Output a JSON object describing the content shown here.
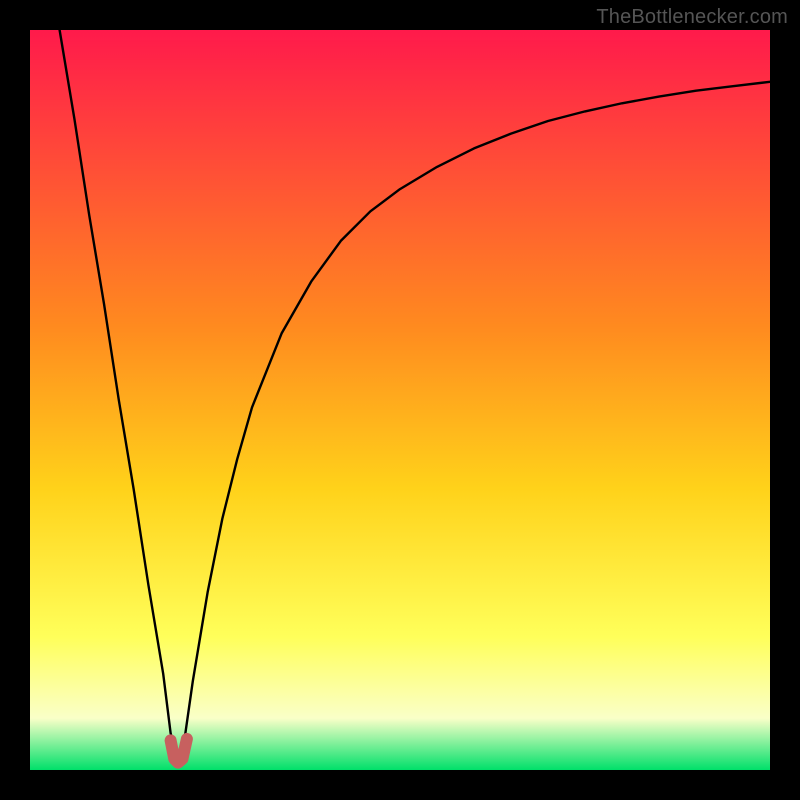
{
  "watermark": "TheBottlenecker.com",
  "colors": {
    "frame": "#000000",
    "gradient_top": "#ff1a4b",
    "gradient_mid1": "#ff8a1f",
    "gradient_mid2": "#ffd21a",
    "gradient_mid3": "#ffff5a",
    "gradient_mid4": "#faffc8",
    "gradient_bottom": "#00e06a",
    "curve": "#000000",
    "marker_fill": "#c7605f",
    "marker_stroke": "#c7605f"
  },
  "chart_data": {
    "type": "line",
    "title": "",
    "xlabel": "",
    "ylabel": "",
    "xlim": [
      0,
      100
    ],
    "ylim": [
      0,
      100
    ],
    "grid": false,
    "optimum_x": 20,
    "series": [
      {
        "name": "bottleneck-curve",
        "x": [
          4,
          6,
          8,
          10,
          12,
          14,
          16,
          18,
          19,
          20,
          21,
          22,
          24,
          26,
          28,
          30,
          34,
          38,
          42,
          46,
          50,
          55,
          60,
          65,
          70,
          75,
          80,
          85,
          90,
          95,
          100
        ],
        "y": [
          100,
          88,
          75,
          63,
          50,
          38,
          25,
          13,
          5,
          1,
          5,
          12,
          24,
          34,
          42,
          49,
          59,
          66,
          71.5,
          75.5,
          78.5,
          81.5,
          84,
          86,
          87.7,
          89,
          90.1,
          91,
          91.8,
          92.4,
          93
        ]
      }
    ],
    "markers": [
      {
        "x": 19.0,
        "y": 4.0
      },
      {
        "x": 19.5,
        "y": 1.5
      },
      {
        "x": 20.0,
        "y": 1.0
      },
      {
        "x": 20.6,
        "y": 1.5
      },
      {
        "x": 21.2,
        "y": 4.2
      }
    ]
  }
}
